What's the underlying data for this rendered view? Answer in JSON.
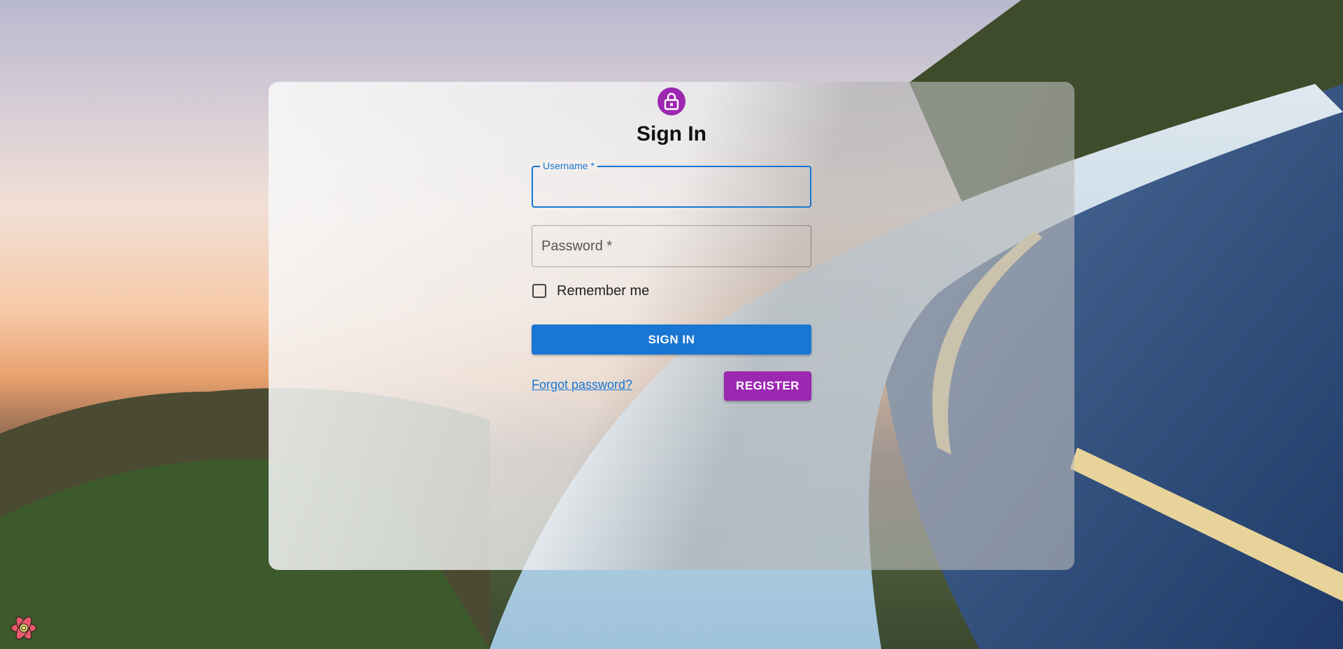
{
  "page": {
    "title": "Sign In"
  },
  "icons": {
    "avatar": "lock-icon",
    "corner": "react-devtools-icon"
  },
  "form": {
    "username": {
      "label": "Username *",
      "value": ""
    },
    "password": {
      "label": "Password *",
      "value": ""
    },
    "remember": {
      "label": "Remember me",
      "checked": false
    },
    "signin_label": "SIGN IN",
    "forgot_label": "Forgot password?",
    "register_label": "REGISTER"
  },
  "colors": {
    "primary": "#1976d2",
    "secondary": "#9c27b0"
  }
}
